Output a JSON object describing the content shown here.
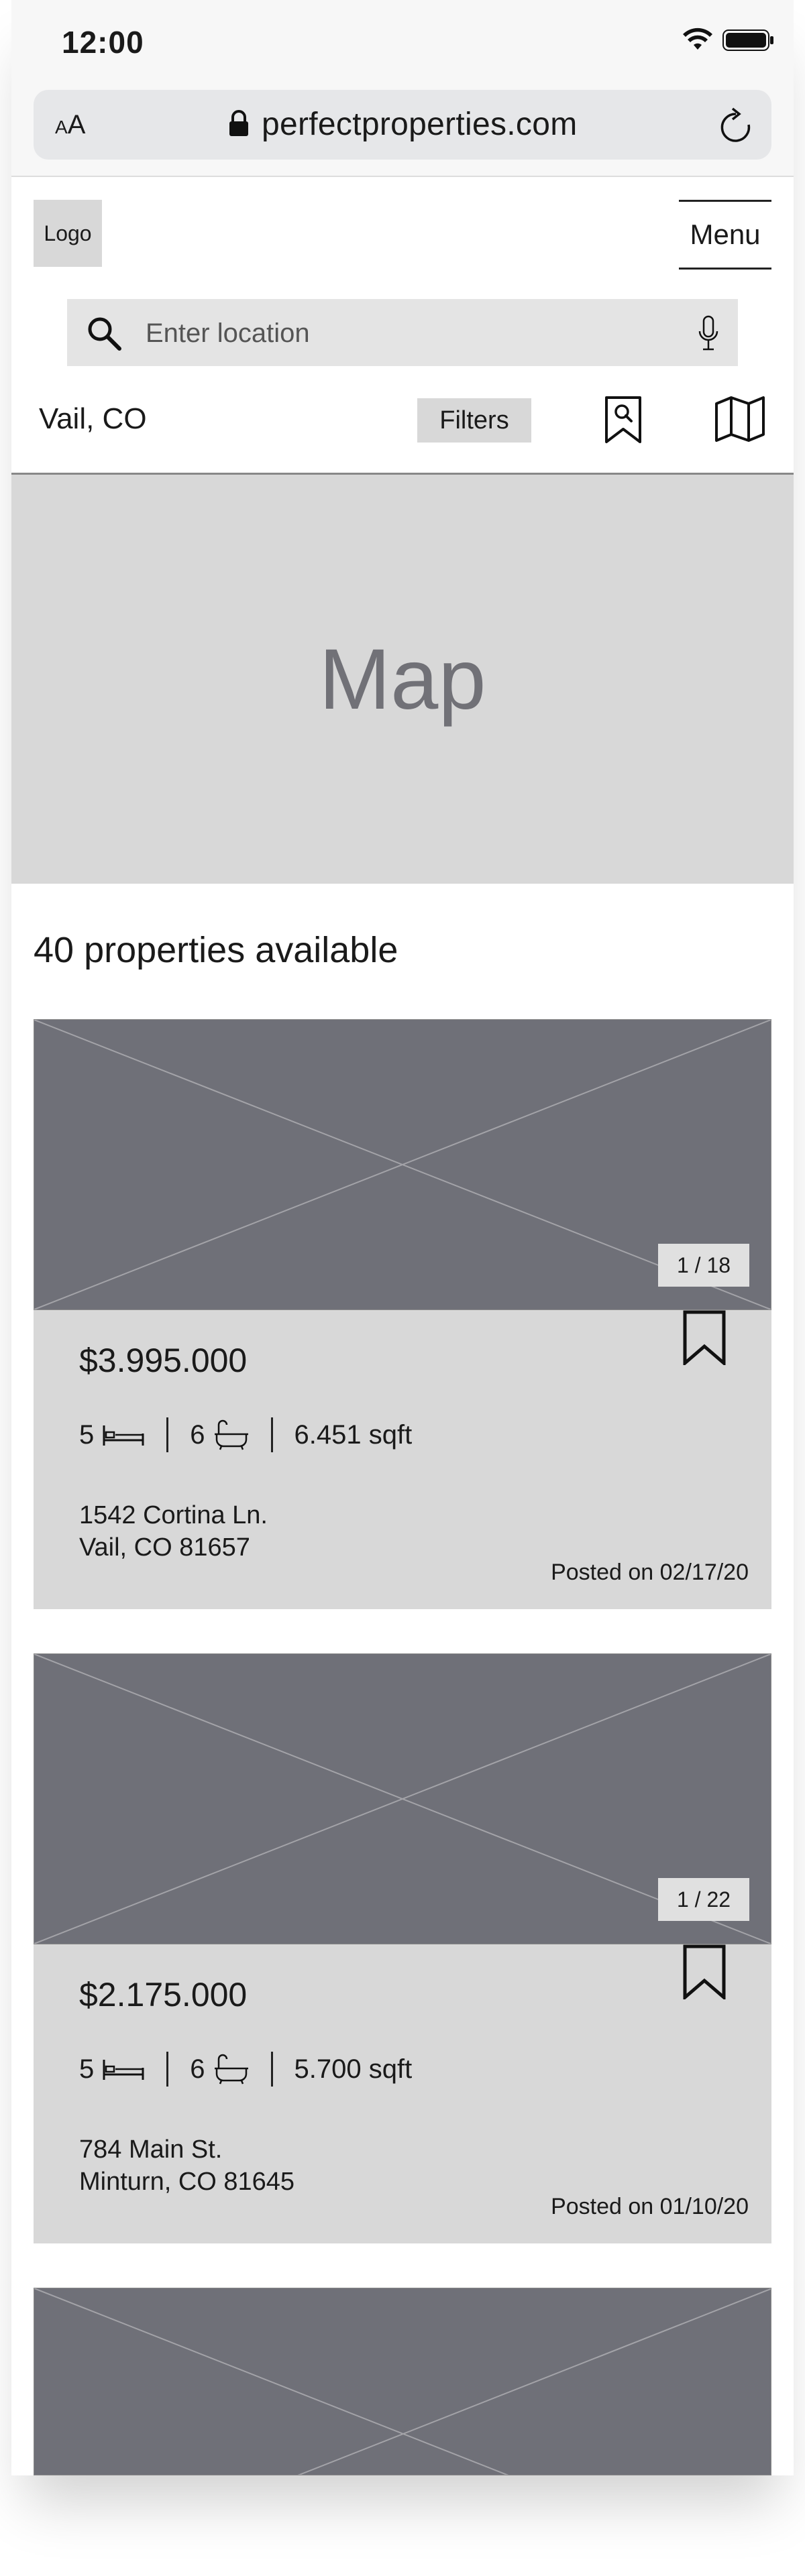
{
  "status_bar": {
    "time": "12:00"
  },
  "browser": {
    "text_size_large": "A",
    "text_size_small": "A",
    "url": "perfectproperties.com"
  },
  "header": {
    "logo": "Logo",
    "menu": "Menu"
  },
  "search": {
    "placeholder": "Enter location"
  },
  "toolbar": {
    "location": "Vail, CO",
    "filters": "Filters"
  },
  "map": {
    "label": "Map"
  },
  "results": {
    "count_text": "40 properties available"
  },
  "listings": [
    {
      "photo_counter": "1 / 18",
      "price": "$3.995.000",
      "beds": "5",
      "baths": "6",
      "sqft": "6.451 sqft",
      "address_line1": "1542 Cortina Ln.",
      "address_line2": "Vail, CO 81657",
      "posted": "Posted on 02/17/20"
    },
    {
      "photo_counter": "1 / 22",
      "price": "$2.175.000",
      "beds": "5",
      "baths": "6",
      "sqft": "5.700 sqft",
      "address_line1": "784 Main St.",
      "address_line2": "Minturn, CO 81645",
      "posted": "Posted on 01/10/20"
    }
  ],
  "colors": {
    "placeholder_gray": "#d8d8d8",
    "photo_gray": "#6f7078",
    "map_text": "#717177"
  }
}
